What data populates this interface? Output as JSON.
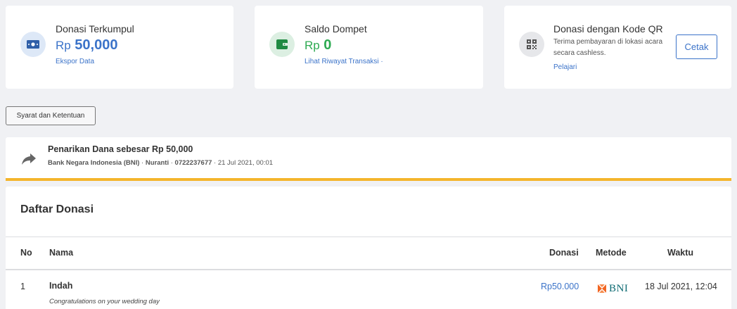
{
  "cards": {
    "donasi": {
      "title": "Donasi Terkumpul",
      "currency": "Rp",
      "amount": "50,000",
      "link": "Ekspor Data"
    },
    "saldo": {
      "title": "Saldo Dompet",
      "currency": "Rp",
      "amount": "0",
      "link": "Lihat Riwayat Transaksi ·"
    },
    "qr": {
      "title": "Donasi dengan Kode QR",
      "description": "Terima pembayaran di lokasi acara secara cashless.",
      "link": "Pelajari",
      "button": "Cetak"
    }
  },
  "terms_button": "Syarat dan Ketentuan",
  "withdrawal": {
    "title": "Penarikan Dana sebesar Rp 50,000",
    "bank": "Bank Negara Indonesia (BNI)",
    "separator": " · ",
    "name": "Nuranti",
    "account": "0722237677",
    "date": "21 Jul 2021, 00:01"
  },
  "donations": {
    "title": "Daftar Donasi",
    "columns": {
      "no": "No",
      "nama": "Nama",
      "donasi": "Donasi",
      "metode": "Metode",
      "waktu": "Waktu"
    },
    "rows": [
      {
        "no": "1",
        "nama": "Indah",
        "message": "Congratulations on your wedding day",
        "amount": "Rp50.000",
        "method": "BNI",
        "time": "18 Jul 2021, 12:04"
      }
    ]
  },
  "colors": {
    "accent": "#3b73c9",
    "success": "#2eaa52",
    "warning": "#f4b52c",
    "background": "#f0f1f4"
  },
  "icons": {
    "donasi": "money-icon",
    "saldo": "wallet-icon",
    "qr": "qr-code-icon",
    "withdrawal": "share-arrow-icon",
    "method": "bni-logo"
  }
}
